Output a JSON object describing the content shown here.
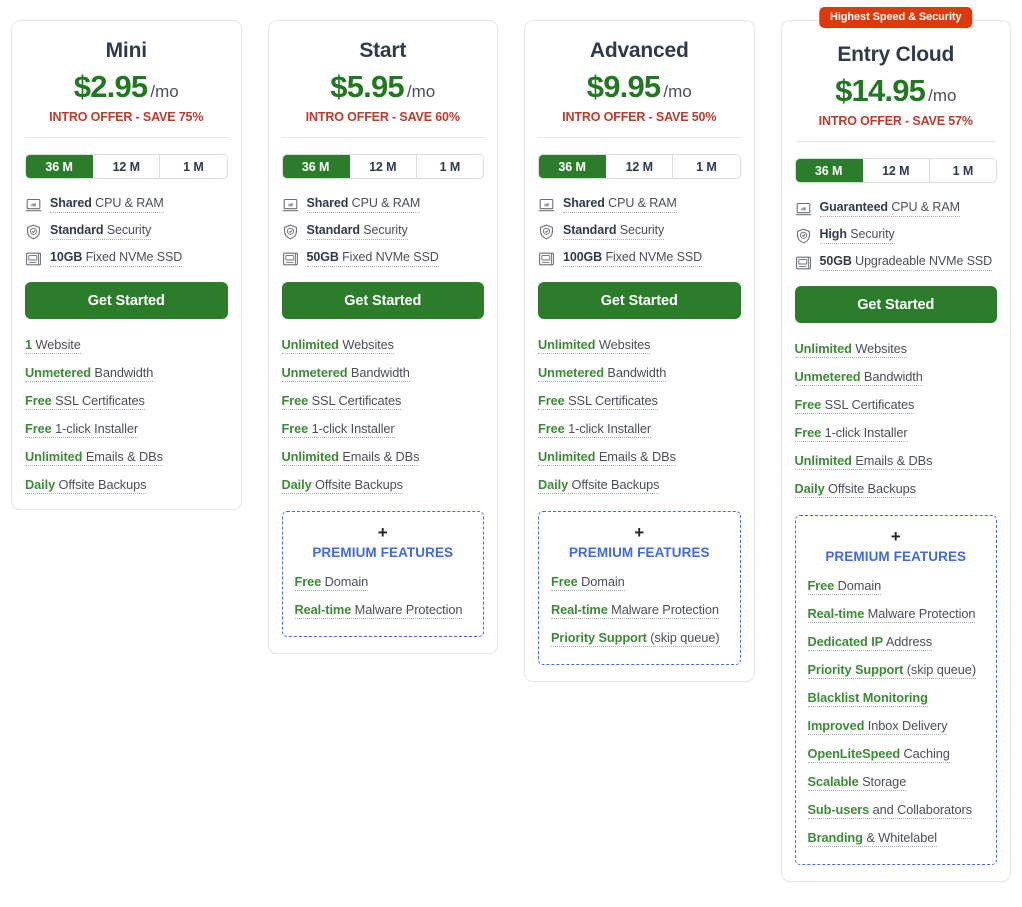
{
  "colors": {
    "price_green": "#217821",
    "button_green": "#2B7D2B",
    "intro_red": "#C0392B",
    "badge_red": "#E0380C",
    "premium_blue": "#4169E1",
    "title_navy": "#2F3A4A",
    "feature_green": "#3D8B37"
  },
  "cta_label": "Get Started",
  "premium_header": {
    "plus": "+",
    "title": "PREMIUM FEATURES"
  },
  "terms": [
    {
      "label": "36 M",
      "active": true
    },
    {
      "label": "12 M",
      "active": false
    },
    {
      "label": "1 M",
      "active": false
    }
  ],
  "plans": [
    {
      "name": "Mini",
      "price": "$2.95",
      "period": "/mo",
      "intro_offer": "INTRO OFFER - SAVE 75%",
      "badge": null,
      "specs": [
        {
          "icon": "cpu-monitor-icon",
          "strong": "Shared",
          "rest": " CPU & RAM"
        },
        {
          "icon": "shield-check-icon",
          "strong": "Standard",
          "rest": " Security"
        },
        {
          "icon": "storage-drive-icon",
          "strong": "10GB",
          "rest": " Fixed NVMe SSD"
        }
      ],
      "features": [
        {
          "strong": "1",
          "rest": " Website"
        },
        {
          "strong": "Unmetered",
          "rest": " Bandwidth"
        },
        {
          "strong": "Free",
          "rest": " SSL Certificates"
        },
        {
          "strong": "Free",
          "rest": " 1-click Installer"
        },
        {
          "strong": "Unlimited",
          "rest": " Emails & DBs"
        },
        {
          "strong": "Daily",
          "rest": " Offsite Backups"
        }
      ],
      "premium_features": []
    },
    {
      "name": "Start",
      "price": "$5.95",
      "period": "/mo",
      "intro_offer": "INTRO OFFER - SAVE 60%",
      "badge": null,
      "specs": [
        {
          "icon": "cpu-monitor-icon",
          "strong": "Shared",
          "rest": " CPU & RAM"
        },
        {
          "icon": "shield-check-icon",
          "strong": "Standard",
          "rest": " Security"
        },
        {
          "icon": "storage-drive-icon",
          "strong": "50GB",
          "rest": " Fixed NVMe SSD"
        }
      ],
      "features": [
        {
          "strong": "Unlimited",
          "rest": " Websites"
        },
        {
          "strong": "Unmetered",
          "rest": " Bandwidth"
        },
        {
          "strong": "Free",
          "rest": " SSL Certificates"
        },
        {
          "strong": "Free",
          "rest": " 1-click Installer"
        },
        {
          "strong": "Unlimited",
          "rest": " Emails & DBs"
        },
        {
          "strong": "Daily",
          "rest": " Offsite Backups"
        }
      ],
      "premium_features": [
        {
          "strong": "Free",
          "rest": " Domain"
        },
        {
          "strong": "Real-time",
          "rest": " Malware Protection"
        }
      ]
    },
    {
      "name": "Advanced",
      "price": "$9.95",
      "period": "/mo",
      "intro_offer": "INTRO OFFER - SAVE 50%",
      "badge": null,
      "specs": [
        {
          "icon": "cpu-monitor-icon",
          "strong": "Shared",
          "rest": " CPU & RAM"
        },
        {
          "icon": "shield-check-icon",
          "strong": "Standard",
          "rest": " Security"
        },
        {
          "icon": "storage-drive-icon",
          "strong": "100GB",
          "rest": " Fixed NVMe SSD"
        }
      ],
      "features": [
        {
          "strong": "Unlimited",
          "rest": " Websites"
        },
        {
          "strong": "Unmetered",
          "rest": " Bandwidth"
        },
        {
          "strong": "Free",
          "rest": " SSL Certificates"
        },
        {
          "strong": "Free",
          "rest": " 1-click Installer"
        },
        {
          "strong": "Unlimited",
          "rest": " Emails & DBs"
        },
        {
          "strong": "Daily",
          "rest": " Offsite Backups"
        }
      ],
      "premium_features": [
        {
          "strong": "Free",
          "rest": " Domain"
        },
        {
          "strong": "Real-time",
          "rest": " Malware Protection"
        },
        {
          "strong": "Priority Support",
          "rest": " (skip queue)"
        }
      ]
    },
    {
      "name": "Entry Cloud",
      "price": "$14.95",
      "period": "/mo",
      "intro_offer": "INTRO OFFER - SAVE 57%",
      "badge": "Highest Speed & Security",
      "specs": [
        {
          "icon": "cpu-monitor-icon",
          "strong": "Guaranteed",
          "rest": " CPU & RAM"
        },
        {
          "icon": "shield-check-icon",
          "strong": "High",
          "rest": " Security"
        },
        {
          "icon": "storage-drive-icon",
          "strong": "50GB",
          "rest": " Upgradeable NVMe SSD"
        }
      ],
      "features": [
        {
          "strong": "Unlimited",
          "rest": " Websites"
        },
        {
          "strong": "Unmetered",
          "rest": " Bandwidth"
        },
        {
          "strong": "Free",
          "rest": " SSL Certificates"
        },
        {
          "strong": "Free",
          "rest": " 1-click Installer"
        },
        {
          "strong": "Unlimited",
          "rest": " Emails & DBs"
        },
        {
          "strong": "Daily",
          "rest": " Offsite Backups"
        }
      ],
      "premium_features": [
        {
          "strong": "Free",
          "rest": " Domain"
        },
        {
          "strong": "Real-time",
          "rest": " Malware Protection"
        },
        {
          "strong": "Dedicated IP",
          "rest": " Address"
        },
        {
          "strong": "Priority Support",
          "rest": " (skip queue)"
        },
        {
          "strong": "Blacklist Monitoring",
          "rest": ""
        },
        {
          "strong": "Improved",
          "rest": " Inbox Delivery"
        },
        {
          "strong": "OpenLiteSpeed",
          "rest": " Caching"
        },
        {
          "strong": "Scalable",
          "rest": " Storage"
        },
        {
          "strong": "Sub-users",
          "rest": " and Collaborators"
        },
        {
          "strong": "Branding",
          "rest": " & Whitelabel"
        }
      ]
    }
  ]
}
